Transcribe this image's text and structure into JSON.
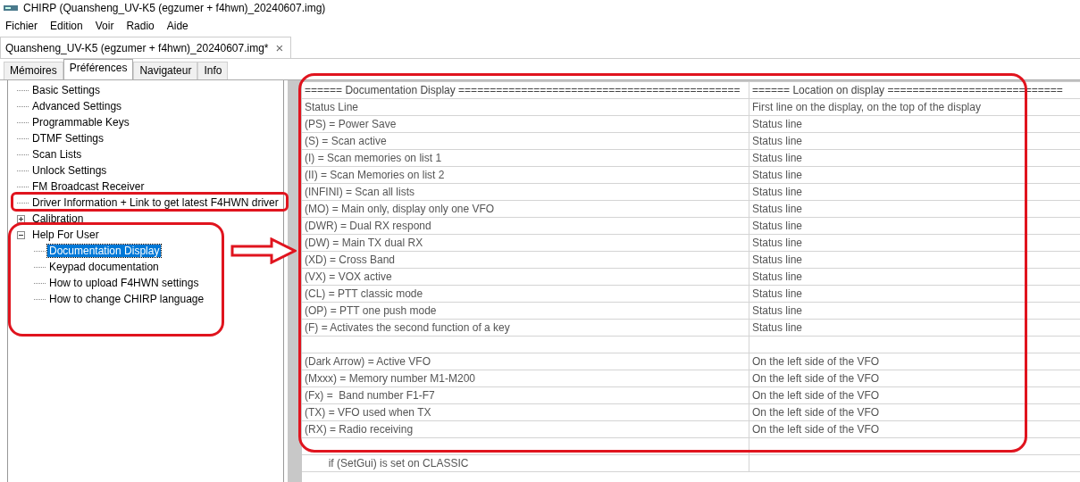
{
  "window": {
    "title": "CHIRP (Quansheng_UV-K5 (egzumer + f4hwn)_20240607.img)"
  },
  "menu": [
    "Fichier",
    "Edition",
    "Voir",
    "Radio",
    "Aide"
  ],
  "file_tabs": [
    {
      "label": "Quansheng_UV-K5 (egzumer + f4hwn)_20240607.img*",
      "selected": true,
      "close": "×"
    }
  ],
  "tabs": [
    {
      "label": "Mémoires",
      "selected": false
    },
    {
      "label": "Préférences",
      "selected": true
    },
    {
      "label": "Navigateur",
      "selected": false
    },
    {
      "label": "Info",
      "selected": false
    }
  ],
  "tree": [
    {
      "label": "Basic Settings",
      "selected": false
    },
    {
      "label": "Advanced Settings",
      "selected": false
    },
    {
      "label": "Programmable Keys",
      "selected": false
    },
    {
      "label": "DTMF Settings",
      "selected": false
    },
    {
      "label": "Scan Lists",
      "selected": false
    },
    {
      "label": "Unlock Settings",
      "selected": false
    },
    {
      "label": "FM Broadcast Receiver",
      "selected": false
    },
    {
      "label": "Driver Information + Link to get latest F4HWN driver",
      "selected": false
    },
    {
      "label": "Calibration",
      "selected": false,
      "expanded": false
    },
    {
      "label": "Help For User",
      "selected": false,
      "expanded": true,
      "children": [
        {
          "label": "Documentation Display",
          "selected": true
        },
        {
          "label": "Keypad documentation",
          "selected": false
        },
        {
          "label": "How to upload F4HWN settings",
          "selected": false
        },
        {
          "label": "How to change CHIRP language",
          "selected": false
        }
      ]
    }
  ],
  "table": {
    "columns": [
      "====== Documentation Display =============================================",
      "====== Location on display ============================"
    ],
    "rows": [
      [
        "Status Line",
        "First line on the display, on the top of the display"
      ],
      [
        "(PS) = Power Save",
        "Status line"
      ],
      [
        "(S) = Scan active",
        "Status line"
      ],
      [
        "(I) = Scan memories on list 1",
        "Status line"
      ],
      [
        "(II) = Scan Memories on list 2",
        "Status line"
      ],
      [
        "(INFINI) = Scan all lists",
        "Status line"
      ],
      [
        "(MO) = Main only, display only one VFO",
        "Status line"
      ],
      [
        "(DWR) = Dual RX respond",
        "Status line"
      ],
      [
        "(DW) = Main TX dual RX",
        "Status line"
      ],
      [
        "(XD) = Cross Band",
        "Status line"
      ],
      [
        "(VX) = VOX active",
        "Status line"
      ],
      [
        "(CL) = PTT classic mode",
        "Status line"
      ],
      [
        "(OP) = PTT one push mode",
        "Status line"
      ],
      [
        "(F) = Activates the second function of a key",
        "Status line"
      ],
      [
        "",
        ""
      ],
      [
        "(Dark Arrow) = Active VFO",
        "On the left side of the VFO"
      ],
      [
        "(Mxxx) = Memory number M1-M200",
        "On the left side of the VFO"
      ],
      [
        "(Fx) =  Band number F1-F7",
        "On the left side of the VFO"
      ],
      [
        "(TX) = VFO used when TX",
        "On the left side of the VFO"
      ],
      [
        "(RX) = Radio receiving",
        "On the left side of the VFO"
      ],
      [
        "",
        ""
      ],
      [
        "        if (SetGui) is set on CLASSIC",
        ""
      ]
    ]
  }
}
